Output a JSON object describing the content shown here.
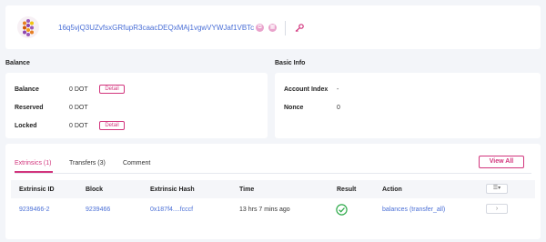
{
  "account": {
    "address": "16q5vjQ3UZvfsxGRfupR3caacDEQxMAj1vgwVYWJaf1VBTc",
    "avatar_icon": "identicon-icon",
    "copy_icon": "copy-icon",
    "qr_icon": "qr-code-icon",
    "key_icon": "key-icon"
  },
  "balance": {
    "title": "Balance",
    "rows": [
      {
        "label": "Balance",
        "value": "0 DOT",
        "action": "Detail"
      },
      {
        "label": "Reserved",
        "value": "0 DOT"
      },
      {
        "label": "Locked",
        "value": "0 DOT",
        "action": "Detail"
      }
    ]
  },
  "basic_info": {
    "title": "Basic Info",
    "rows": [
      {
        "label": "Account Index",
        "value": "-"
      },
      {
        "label": "Nonce",
        "value": "0"
      }
    ]
  },
  "tabs": {
    "items": [
      {
        "label": "Extrinsics (1)",
        "active": true
      },
      {
        "label": "Transfers (3)"
      },
      {
        "label": "Comment"
      }
    ],
    "view_all": "View All"
  },
  "table": {
    "headers": [
      "Extrinsic ID",
      "Block",
      "Extrinsic Hash",
      "Time",
      "Result",
      "Action"
    ],
    "rows": [
      {
        "extrinsic_id": "9239466-2",
        "block": "9239466",
        "hash": "0x187f4....fcccf",
        "time": "13 hrs 7 mins ago",
        "result": "success-check-icon",
        "action": "balances (transfer_all)"
      }
    ]
  },
  "colors": {
    "accent": "#d2357d",
    "link": "#4a6fd6",
    "success": "#2eaa4a"
  }
}
